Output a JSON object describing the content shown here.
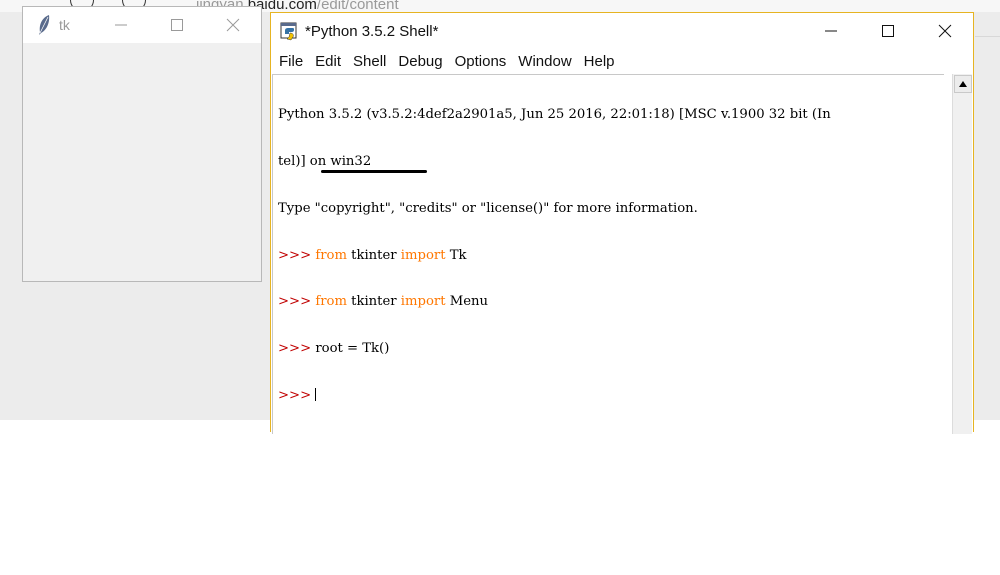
{
  "background": {
    "url_prefix": "jingyan.",
    "url_host": "baidu.com",
    "url_path": "/edit/content"
  },
  "tk_window": {
    "title": "tk",
    "icon": "feather-icon",
    "controls": {
      "minimize": "minimize-icon",
      "maximize": "maximize-icon",
      "close": "close-icon"
    }
  },
  "shell_window": {
    "title": "*Python 3.5.2 Shell*",
    "icon": "python-idle-icon",
    "border_color": "#e6b422",
    "menu": [
      "File",
      "Edit",
      "Shell",
      "Debug",
      "Options",
      "Window",
      "Help"
    ],
    "lines": {
      "l1": "Python 3.5.2 (v3.5.2:4def2a2901a5, Jun 25 2016, 22:01:18) [MSC v.1900 32 bit (In",
      "l2": "tel)] on win32",
      "l3": "Type \"copyright\", \"credits\" or \"license()\" for more information."
    },
    "commands": [
      {
        "prompt": ">>> ",
        "kw1": "from",
        "mod": " tkinter ",
        "kw2": "import",
        "name": " Tk"
      },
      {
        "prompt": ">>> ",
        "kw1": "from",
        "mod": " tkinter ",
        "kw2": "import",
        "name": " Menu"
      },
      {
        "prompt": ">>> ",
        "text": "root = Tk()"
      },
      {
        "prompt": ">>> "
      }
    ],
    "colors": {
      "prompt": "#c00000",
      "keyword": "#ff7700"
    }
  }
}
